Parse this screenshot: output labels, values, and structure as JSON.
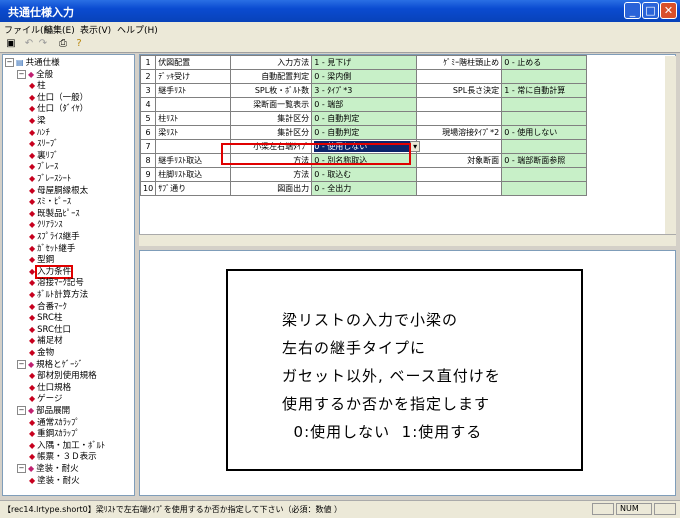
{
  "window": {
    "title": "共通仕様入力",
    "min_glyph": "_",
    "max_glyph": "□",
    "close_glyph": "✕"
  },
  "menu": [
    "ファイル(F)",
    "編集(E)",
    "表示(V)",
    "ヘルプ(H)"
  ],
  "toolbar_icons": [
    "save-icon",
    "undo-icon",
    "redo-icon",
    "print-icon",
    "help-icon"
  ],
  "tree": [
    {
      "label": "共通仕様",
      "level": 0,
      "exp": "−",
      "icon": "computer-icon"
    },
    {
      "label": "全般",
      "level": 1,
      "exp": "−",
      "icon": "folder-icon"
    },
    {
      "label": "柱",
      "level": 2
    },
    {
      "label": "仕口（一般）",
      "level": 2
    },
    {
      "label": "仕口（ﾀﾞｲﾔ）",
      "level": 2
    },
    {
      "label": "梁",
      "level": 2
    },
    {
      "label": "ﾊﾝﾁ",
      "level": 2
    },
    {
      "label": "ｽﾘｰﾌﾞ",
      "level": 2
    },
    {
      "label": "裏ﾘﾌﾞ",
      "level": 2
    },
    {
      "label": "ﾌﾞﾚｰｽ",
      "level": 2
    },
    {
      "label": "ﾌﾞﾚｰｽｼｰﾄ",
      "level": 2
    },
    {
      "label": "母屋胴縁根太",
      "level": 2
    },
    {
      "label": "ｽﾐ・ﾋﾟｰｽ",
      "level": 2
    },
    {
      "label": "既製品ﾋﾟｰｽ",
      "level": 2
    },
    {
      "label": "ｸﾘｱﾗﾝｽ",
      "level": 2
    },
    {
      "label": "ｽﾌﾟﾗｲｽ継手",
      "level": 2
    },
    {
      "label": "ｶﾞｾｯﾄ継手",
      "level": 2
    },
    {
      "label": "型鋼",
      "level": 2
    },
    {
      "label": "入力条件",
      "level": 2,
      "highlight": true
    },
    {
      "label": "溶接ﾏｰｸ記号",
      "level": 2
    },
    {
      "label": "ﾎﾞﾙﾄ計算方法",
      "level": 2
    },
    {
      "label": "合番ﾏｰｸ",
      "level": 2
    },
    {
      "label": "SRC柱",
      "level": 2
    },
    {
      "label": "SRC仕口",
      "level": 2
    },
    {
      "label": "補足材",
      "level": 2
    },
    {
      "label": "金物",
      "level": 2
    },
    {
      "label": "規格とｹﾞｰｼﾞ",
      "level": 1,
      "exp": "−",
      "icon": "folder-icon"
    },
    {
      "label": "部材別使用規格",
      "level": 2
    },
    {
      "label": "仕口規格",
      "level": 2
    },
    {
      "label": "ゲージ",
      "level": 2
    },
    {
      "label": "部品展開",
      "level": 1,
      "exp": "−",
      "icon": "folder-icon"
    },
    {
      "label": "通常ｽｶﾗｯﾌﾟ",
      "level": 2
    },
    {
      "label": "重鋼ｽｶﾗｯﾌﾟ",
      "level": 2
    },
    {
      "label": "入隅・加工・ﾎﾞﾙﾄ",
      "level": 2
    },
    {
      "label": "帳票・３Ｄ表示",
      "level": 2
    },
    {
      "label": "塗装・耐火",
      "level": 1,
      "exp": "−",
      "icon": "folder-icon"
    },
    {
      "label": "塗装・耐火",
      "level": 2
    }
  ],
  "grid_rows": [
    {
      "n": "1",
      "c1": "伏図配置",
      "c2": "入力方法",
      "c3": "1 - 見下げ",
      "c4": "ｹﾞﾐｰ階柱頭止め",
      "c5": "0 - 止める"
    },
    {
      "n": "2",
      "c1": "ﾃﾞｯｷ受け",
      "c2": "自動配置判定",
      "c3": "0 - 梁内側",
      "c4": "",
      "c5": ""
    },
    {
      "n": "3",
      "c1": "継手ﾘｽﾄ",
      "c2": "SPL枚・ﾎﾞﾙﾄ数",
      "c3": "3 - ﾀｲﾌﾟ*3",
      "c4": "SPL長さ決定",
      "c5": "1 - 常に自動計算"
    },
    {
      "n": "4",
      "c1": "",
      "c2": "梁断面一覧表示",
      "c3": "0 - 端部",
      "c4": "",
      "c5": ""
    },
    {
      "n": "5",
      "c1": "柱ﾘｽﾄ",
      "c2": "集計区分",
      "c3": "0 - 自動判定",
      "c4": "",
      "c5": ""
    },
    {
      "n": "6",
      "c1": "梁ﾘｽﾄ",
      "c2": "集計区分",
      "c3": "0 - 自動判定",
      "c4": "現場溶接ﾀｲﾌﾟ*2",
      "c5": "0 - 使用しない"
    },
    {
      "n": "7",
      "c1": "",
      "c2": "小梁左右端ﾀｲﾌﾟ",
      "c3": "0 - 使用しない",
      "c4": "",
      "c5": "",
      "dropdown": true
    },
    {
      "n": "8",
      "c1": "継手ﾘｽﾄ取込",
      "c2": "方法",
      "c3": "0 - 別名称取込",
      "c4": "対象断面",
      "c5": "0 - 端部断面参照"
    },
    {
      "n": "9",
      "c1": "柱脚ﾘｽﾄ取込",
      "c2": "方法",
      "c3": "0 - 取込む",
      "c4": "",
      "c5": ""
    },
    {
      "n": "10",
      "c1": "ｻﾌﾞ通り",
      "c2": "図面出力",
      "c3": "0 - 全出力",
      "c4": "",
      "c5": ""
    }
  ],
  "description_lines": [
    "梁リストの入力で小梁の",
    "左右の継手タイプに",
    "ガセット以外, ベース直付けを",
    "使用するか否かを指定します",
    "  0:使用しない  1:使用する"
  ],
  "status": {
    "text": "【rec14.lrtype.short0】梁ﾘｽﾄで左右端ﾀｲﾌﾟを使用するか否か指定して下さい（必須：数値 ）",
    "num": "NUM"
  }
}
